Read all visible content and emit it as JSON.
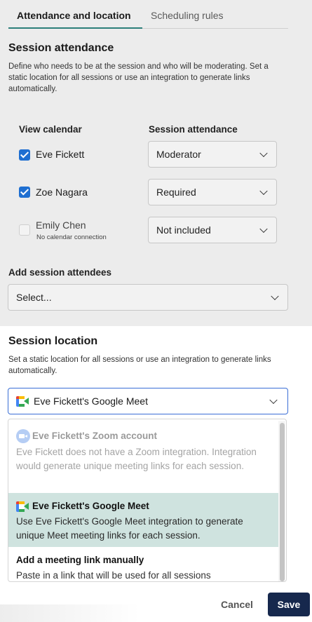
{
  "tabs": [
    {
      "label": "Attendance and location",
      "active": true
    },
    {
      "label": "Scheduling rules",
      "active": false
    }
  ],
  "attendance": {
    "title": "Session attendance",
    "description": "Define who needs to be at the session and who will be moderating. Set a static location for all sessions or use an integration to generate links automatically.",
    "col_calendar": "View calendar",
    "col_attendance": "Session attendance",
    "people": [
      {
        "name": "Eve Fickett",
        "checked": true,
        "attendance": "Moderator"
      },
      {
        "name": "Zoe Nagara",
        "checked": true,
        "attendance": "Required"
      },
      {
        "name": "Emily Chen",
        "checked": false,
        "note": "No calendar connection",
        "attendance": "Not included"
      }
    ]
  },
  "attendees": {
    "label": "Add session attendees",
    "placeholder": "Select..."
  },
  "location": {
    "title": "Session location",
    "description": "Set a static location for all sessions or use an integration to generate links automatically.",
    "selected": "Eve Fickett's Google Meet",
    "options": [
      {
        "title": "Eve Fickett's Zoom account",
        "description": "Eve Fickett does not have a Zoom integration. Integration would generate unique meeting links for each session.",
        "icon": "zoom-icon",
        "disabled": true
      },
      {
        "title": "Eve Fickett's Google Meet",
        "description": "Use Eve Fickett's Google Meet integration to generate unique Meet meeting links for each session.",
        "icon": "google-meet-icon",
        "selected": true
      },
      {
        "title": "Add a meeting link manually",
        "description": "Paste in a link that will be used for all sessions"
      }
    ]
  },
  "footer": {
    "cancel": "Cancel",
    "save": "Save"
  },
  "colors": {
    "accent_tab": "#2d7f7a",
    "checkbox": "#1f6fd1",
    "selected_option": "#cfe3df",
    "save_button": "#16284d"
  }
}
